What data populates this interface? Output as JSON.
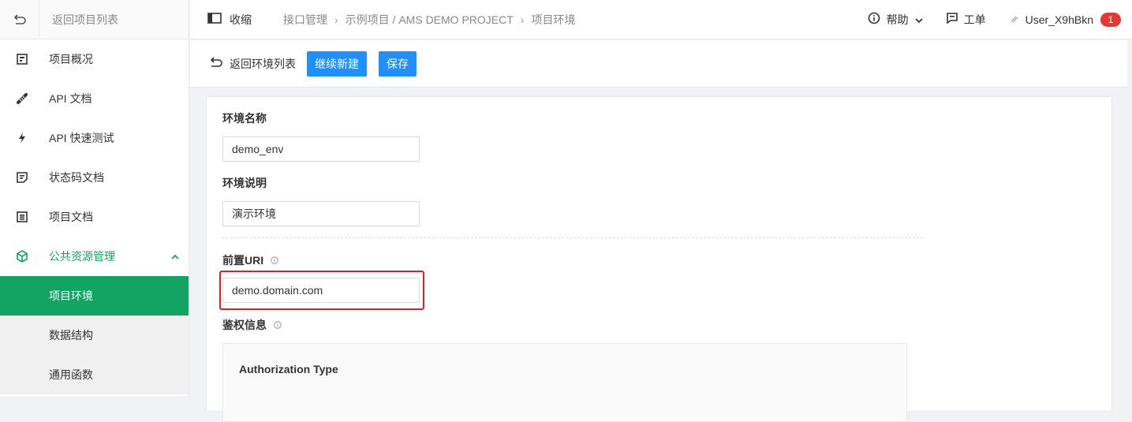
{
  "sidebar": {
    "back_label": "返回项目列表",
    "items": [
      {
        "label": "项目概况",
        "icon": "dashboard-icon"
      },
      {
        "label": "API 文档",
        "icon": "api-doc-icon"
      },
      {
        "label": "API 快速测试",
        "icon": "lightning-icon"
      },
      {
        "label": "状态码文档",
        "icon": "status-doc-icon"
      },
      {
        "label": "项目文档",
        "icon": "document-icon"
      }
    ],
    "group": {
      "label": "公共资源管理",
      "icon": "cube-icon",
      "expanded": true
    },
    "sub_items": [
      {
        "label": "项目环境",
        "active": true
      },
      {
        "label": "数据结构",
        "active": false
      },
      {
        "label": "通用函数",
        "active": false
      }
    ],
    "accent_color": "#13a463"
  },
  "topbar": {
    "collapse_label": "收缩",
    "breadcrumbs": [
      "接口管理",
      "示例项目 / AMS DEMO PROJECT",
      "项目环境"
    ],
    "help_label": "帮助",
    "ticket_label": "工单",
    "user_name": "User_X9hBkn",
    "notification_count": "1"
  },
  "toolbar": {
    "back_label": "返回环境列表",
    "continue_new_label": "继续新建",
    "save_label": "保存",
    "button_color": "#1e90ff"
  },
  "form": {
    "env_name_label": "环境名称",
    "env_name_value": "demo_env",
    "env_desc_label": "环境说明",
    "env_desc_value": "演示环境",
    "prefix_uri_label": "前置URI",
    "prefix_uri_value": "demo.domain.com",
    "auth_label": "鉴权信息",
    "auth_type_label": "Authorization Type"
  }
}
